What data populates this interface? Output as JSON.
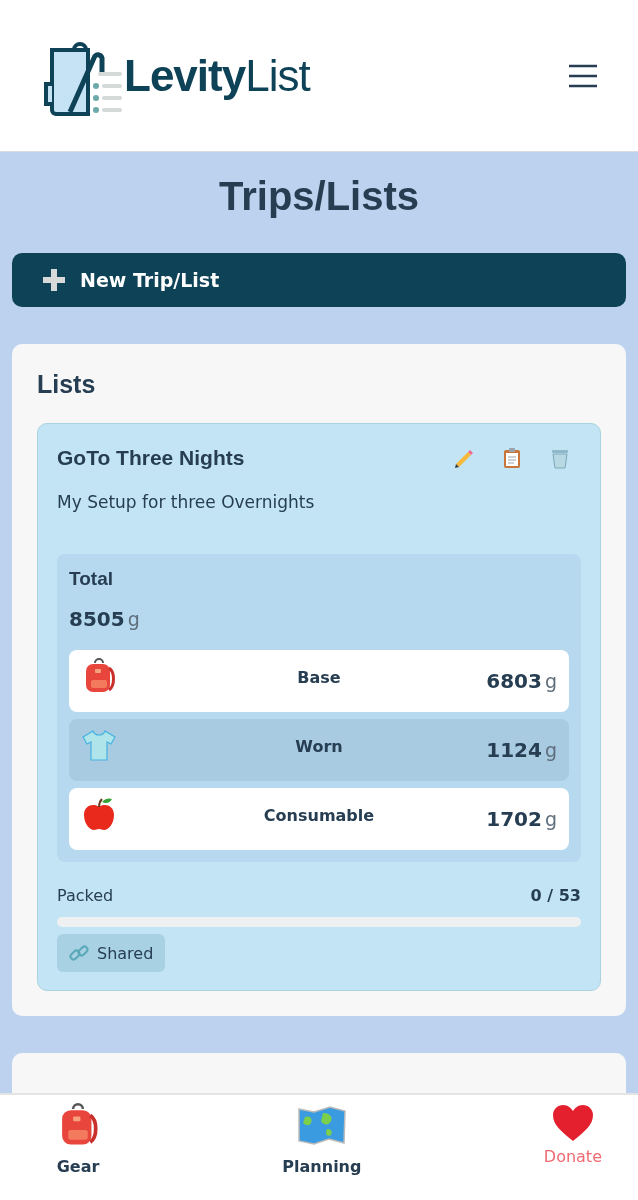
{
  "header": {
    "logo": "**Levity**List"
  },
  "page": {
    "title": "Trips/Lists",
    "new_button": "New Trip/List"
  },
  "lists_panel": {
    "title": "Lists",
    "cards": [
      {
        "name": "GoTo Three Nights",
        "description": "My Setup for three Overnights",
        "total": {
          "label": "Total",
          "value": "8505",
          "unit": "g"
        },
        "categories": [
          {
            "kind": "base",
            "label": "Base",
            "value": "6803",
            "unit": "g",
            "selected": false
          },
          {
            "kind": "worn",
            "label": "Worn",
            "value": "1124",
            "unit": "g",
            "selected": true
          },
          {
            "kind": "consumable",
            "label": "Consumable",
            "value": "1702",
            "unit": "g",
            "selected": false
          }
        ],
        "packed": {
          "label": "Packed",
          "count": "0 / 53",
          "level": 0
        },
        "shared": {
          "label": "Shared"
        }
      }
    ]
  },
  "bottom_nav": [
    {
      "kind": "gear",
      "label": "Gear"
    },
    {
      "kind": "planning",
      "label": "Planning"
    },
    {
      "kind": "donate",
      "label": "Donate"
    }
  ]
}
